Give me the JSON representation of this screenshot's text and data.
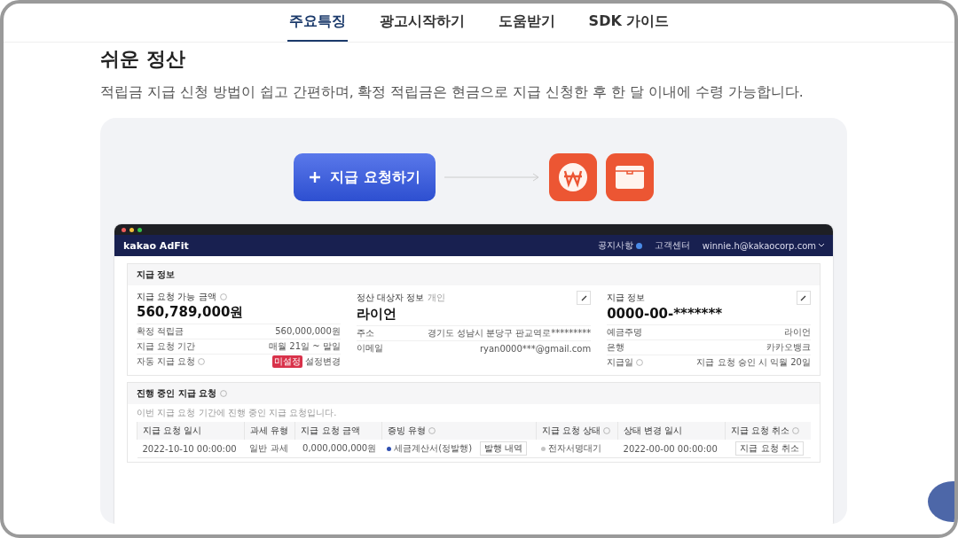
{
  "nav": {
    "tabs": [
      {
        "label": "주요특징",
        "selected": true
      },
      {
        "label": "광고시작하기",
        "selected": false
      },
      {
        "label": "도움받기",
        "selected": false
      },
      {
        "label": "SDK 가이드",
        "selected": false
      }
    ]
  },
  "section": {
    "title": "쉬운 정산",
    "description": "적립금 지급 신청 방법이 쉽고 간편하며, 확정 적립금은 현금으로 지급 신청한 후 한 달 이내에 수령 가능합니다."
  },
  "illustration": {
    "button_label": "지급 요청하기"
  },
  "mockup": {
    "brand": "kakao AdFit",
    "header_links": [
      {
        "label": "공지사항",
        "badge": true
      },
      {
        "label": "고객센터",
        "badge": false
      }
    ],
    "account": "winnie.h@kakaocorp.com",
    "info": {
      "title": "지급 정보",
      "panels": [
        {
          "label": "지급 요청 가능 금액",
          "help": true,
          "editable": false,
          "value": "560,789,000원",
          "rows": [
            {
              "label": "확정 적립금",
              "help": false,
              "value": "560,000,000원"
            },
            {
              "label": "지급 요청 기간",
              "help": false,
              "value": "매월 21일 ~ 말일"
            },
            {
              "label": "자동 지급 요청",
              "help": true,
              "tag": "미설정",
              "value": "설정변경"
            }
          ]
        },
        {
          "label": "정산 대상자 정보",
          "note": "개인",
          "help": false,
          "editable": true,
          "value": "라이언",
          "rows": [
            {
              "label": "주소",
              "help": false,
              "value": "경기도 성남시 분당구 판교역로*********"
            },
            {
              "label": "이메일",
              "help": false,
              "value": "ryan0000***@gmail.com"
            }
          ]
        },
        {
          "label": "지급 정보",
          "help": false,
          "editable": true,
          "value": "0000-00-*******",
          "rows": [
            {
              "label": "예금주명",
              "help": false,
              "value": "라이언"
            },
            {
              "label": "은행",
              "help": false,
              "value": "카카오뱅크"
            },
            {
              "label": "지급일",
              "help": true,
              "value": "지급 요청 승인 시 익월 20일"
            }
          ]
        }
      ]
    },
    "requests": {
      "title": "진행 중인 지급 요청",
      "help": true,
      "description": "이번 지급 요청 기간에 진행 중인 지급 요청입니다.",
      "columns": [
        {
          "label": "지급 요청 일시",
          "help": false
        },
        {
          "label": "과세 유형",
          "help": false
        },
        {
          "label": "지급 요청 금액",
          "help": false
        },
        {
          "label": "증빙 유형",
          "help": true
        },
        {
          "label": "지급 요청 상태",
          "help": true
        },
        {
          "label": "상태 변경 일시",
          "help": false
        },
        {
          "label": "지급 요청 취소",
          "help": true
        }
      ],
      "rows": [
        {
          "cells": [
            {
              "kind": "text",
              "text": "2022-10-10 00:00:00"
            },
            {
              "kind": "text",
              "text": "일반 과세"
            },
            {
              "kind": "amount",
              "text": "0,000,000,000원"
            },
            {
              "kind": "status",
              "text": "세금계산서(정발행)",
              "color": "#2f4fb0",
              "action": "발행 내역"
            },
            {
              "kind": "status",
              "text": "전자서명대기",
              "color": "#c4c4c4"
            },
            {
              "kind": "text",
              "text": "2022-00-00 00:00:00"
            },
            {
              "kind": "button",
              "text": "지급 요청 취소"
            }
          ]
        }
      ]
    }
  }
}
